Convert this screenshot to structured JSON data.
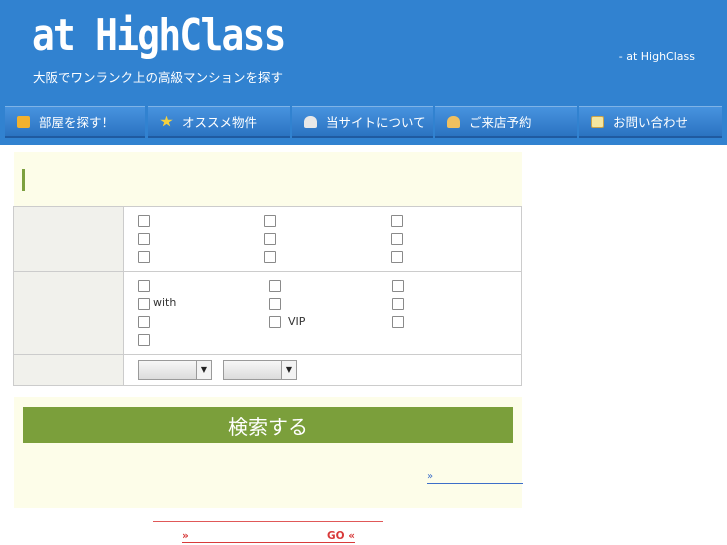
{
  "header": {
    "logo": "at HighClass",
    "tagline": "大阪でワンランク上の高級マンションを探す",
    "right_text": "- at HighClass"
  },
  "nav": {
    "items": [
      {
        "label": "部屋を探す！",
        "icon": "house-icon",
        "color": "#f2b12e"
      },
      {
        "label": "オススメ物件",
        "icon": "star-icon",
        "color": "#f4d03f"
      },
      {
        "label": "当サイトについて",
        "icon": "person-icon",
        "color": "#e8e8e8"
      },
      {
        "label": "ご来店予約",
        "icon": "people-icon",
        "color": "#f0c060"
      },
      {
        "label": "お問い合わせ",
        "icon": "mail-icon",
        "color": "#f5e6a0"
      }
    ]
  },
  "search": {
    "row2_labels": {
      "with": "with",
      "vip": "VIP"
    },
    "button_label": "検索する"
  },
  "links": {
    "more": "»",
    "go_left": "»",
    "go_right": "GO «"
  },
  "colors": {
    "header_blue": "#3182d0",
    "accent_green": "#7b9f3b",
    "panel_cream": "#fdfde9",
    "link_blue": "#3d6fc9",
    "link_red": "#d83a3a"
  }
}
